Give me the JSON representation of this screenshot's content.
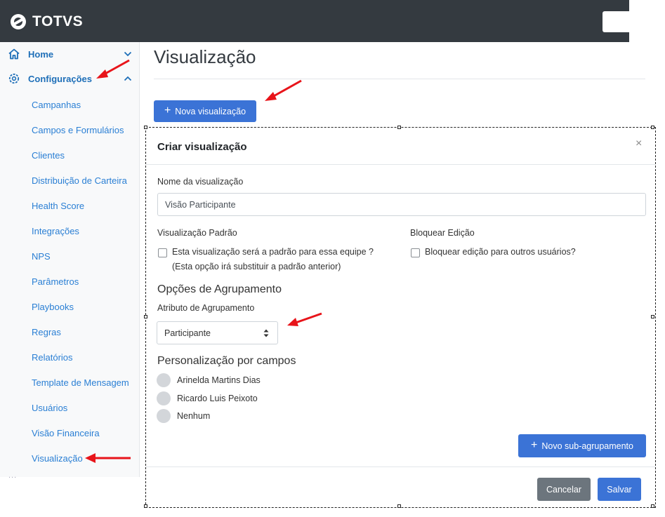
{
  "brand": {
    "name": "TOTVS"
  },
  "sidebar": {
    "home_label": "Home",
    "config_label": "Configurações",
    "items": [
      {
        "label": "Campanhas"
      },
      {
        "label": "Campos e Formulários"
      },
      {
        "label": "Clientes"
      },
      {
        "label": "Distribuição de Carteira"
      },
      {
        "label": "Health Score"
      },
      {
        "label": "Integrações"
      },
      {
        "label": "NPS"
      },
      {
        "label": "Parâmetros"
      },
      {
        "label": "Playbooks"
      },
      {
        "label": "Regras"
      },
      {
        "label": "Relatórios"
      },
      {
        "label": "Template de Mensagem"
      },
      {
        "label": "Usuários"
      },
      {
        "label": "Visão Financeira"
      },
      {
        "label": "Visualização"
      }
    ],
    "more": "..."
  },
  "main": {
    "title": "Visualização",
    "new_button": "Nova visualização"
  },
  "modal": {
    "title": "Criar visualização",
    "close": "×",
    "name_label": "Nome da visualização",
    "name_value": "Visão Participante",
    "default_label": "Visualização Padrão",
    "default_checkbox": "Esta visualização será a padrão para essa equipe ?",
    "default_hint": "(Esta opção irá substituir a padrão anterior)",
    "lock_label": "Bloquear Edição",
    "lock_checkbox": "Bloquear edição para outros usuários?",
    "grouping_title": "Opções de Agrupamento",
    "grouping_attr_label": "Atributo de Agrupamento",
    "grouping_attr_value": "Participante",
    "custom_title": "Personalização por campos",
    "people": [
      {
        "name": "Arinelda Martins Dias"
      },
      {
        "name": "Ricardo Luis Peixoto"
      },
      {
        "name": "Nenhum"
      }
    ],
    "sub_group_button": "Novo sub-agrupamento",
    "cancel_button": "Cancelar",
    "save_button": "Salvar"
  },
  "colors": {
    "topbar": "#343a40",
    "primary": "#3b73d6",
    "secondary": "#6c757d",
    "link": "#2a7fd4",
    "annotation_arrow": "#e8141a"
  },
  "icons": {
    "home": "home-icon",
    "settings": "gear-icon",
    "expand": "chevron-down-icon",
    "collapse": "chevron-up-icon",
    "close": "close-icon",
    "plus": "plus-icon",
    "select": "sort-arrows-icon"
  }
}
